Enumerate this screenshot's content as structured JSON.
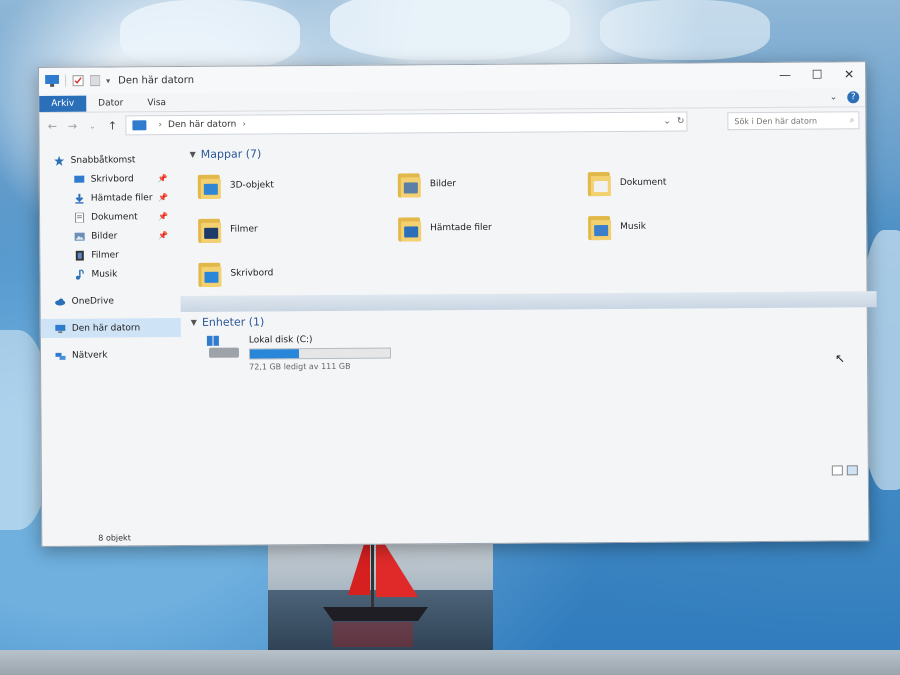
{
  "window": {
    "title": "Den här datorn",
    "controls": {
      "minimize": "—",
      "maximize": "☐",
      "close": "✕"
    }
  },
  "ribbon": {
    "tabs": [
      "Arkiv",
      "Dator",
      "Visa"
    ],
    "expand": "⌄",
    "help": "?"
  },
  "address": {
    "back": "←",
    "forward": "→",
    "recent": "⌄",
    "up": "↑",
    "path_separator": "›",
    "path": "Den här datorn",
    "path_end_separator": "›",
    "dropdown": "⌄",
    "refresh": "↻",
    "search_placeholder": "Sök i Den här datorn",
    "search_icon": "⌕"
  },
  "nav": {
    "quick_access": "Snabbåtkomst",
    "quick_items": [
      {
        "label": "Skrivbord",
        "pinned": true
      },
      {
        "label": "Hämtade filer",
        "pinned": true
      },
      {
        "label": "Dokument",
        "pinned": true
      },
      {
        "label": "Bilder",
        "pinned": true
      },
      {
        "label": "Filmer",
        "pinned": false
      },
      {
        "label": "Musik",
        "pinned": false
      }
    ],
    "onedrive": "OneDrive",
    "this_pc": "Den här datorn",
    "network": "Nätverk",
    "pin_glyph": "📌"
  },
  "content": {
    "folders_header": "Mappar (7)",
    "folders": [
      {
        "label": "3D-objekt",
        "icon": "3d-objects-folder-icon",
        "badge": "#2f86d4"
      },
      {
        "label": "Bilder",
        "icon": "pictures-folder-icon",
        "badge": "#5b7fa6"
      },
      {
        "label": "Dokument",
        "icon": "documents-folder-icon",
        "badge": "#f1f1f1"
      },
      {
        "label": "Filmer",
        "icon": "videos-folder-icon",
        "badge": "#1c3b6b"
      },
      {
        "label": "Hämtade filer",
        "icon": "downloads-folder-icon",
        "badge": "#2b6fb9"
      },
      {
        "label": "Musik",
        "icon": "music-folder-icon",
        "badge": "#3a7ecc"
      },
      {
        "label": "Skrivbord",
        "icon": "desktop-folder-icon",
        "badge": "#2a86d8"
      }
    ],
    "devices_header": "Enheter (1)",
    "drive": {
      "label": "Lokal disk (C:)",
      "free_text": "72,1 GB ledigt av 111 GB",
      "used_fraction": 0.35
    }
  },
  "status": {
    "count": "8 objekt"
  },
  "colors": {
    "accent": "#2b6fb9",
    "selection": "#cfe3f7",
    "drive_fill": "#2a86d8"
  }
}
